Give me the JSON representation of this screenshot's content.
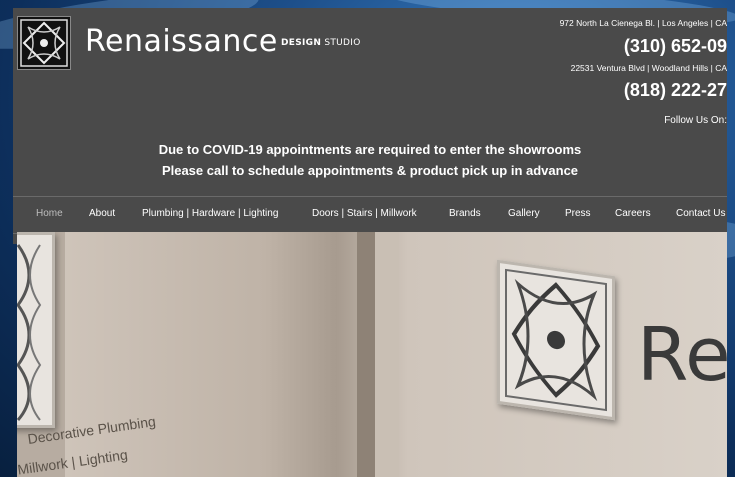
{
  "header": {
    "brand_name": "Renaissance",
    "brand_sub_bold": "DESIGN",
    "brand_sub_rest": " STUDIO",
    "address_1": "972 North La Cienega Bl. | Los Angeles | CA",
    "phone_1": "(310) 652-09",
    "address_2": "22531 Ventura Blvd | Woodland Hills | CA",
    "phone_2": "(818) 222-27",
    "follow": "Follow Us On:"
  },
  "notice": {
    "line1": "Due to COVID-19 appointments are required to enter the showrooms",
    "line2": "Please call to schedule appointments & product pick up  in advance"
  },
  "nav": {
    "items": [
      {
        "label": "Home"
      },
      {
        "label": "About"
      },
      {
        "label": "Plumbing | Hardware | Lighting"
      },
      {
        "label": "Doors | Stairs | Millwork"
      },
      {
        "label": "Brands"
      },
      {
        "label": "Gallery"
      },
      {
        "label": "Press"
      },
      {
        "label": "Careers"
      },
      {
        "label": "Contact Us"
      }
    ]
  },
  "hero": {
    "letters": "Re",
    "sign_line1": "Decorative Plumbing",
    "sign_line2": "Millwork  |  Lighting"
  },
  "colors": {
    "panel_bg": "#4a4a4a",
    "page_bg": "#0d2f5c"
  }
}
